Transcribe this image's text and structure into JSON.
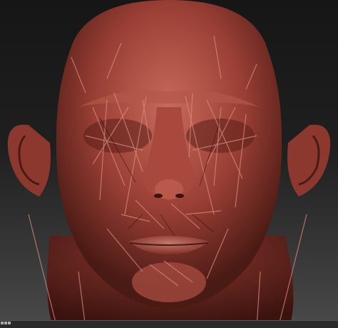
{
  "window": {
    "canvas_label": "",
    "colors": {
      "background_top": "#161616",
      "background_bottom": "#4a4a4a",
      "clay": "#9a3f35",
      "clay_highlight": "#c86a5c",
      "clay_shadow": "#4a1a14"
    }
  },
  "viewport": {
    "subject": "head-sculpt",
    "material": "red-clay-matcap"
  },
  "status_bar": {
    "icons": [
      "navigation-marker-icon"
    ]
  }
}
